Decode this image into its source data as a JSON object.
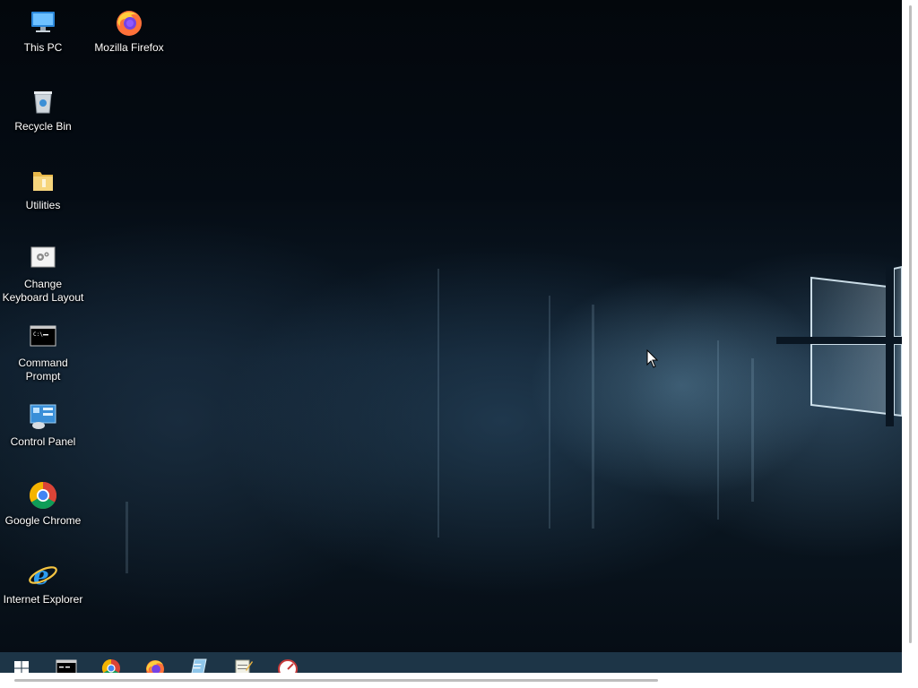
{
  "desktop": {
    "icons": [
      {
        "label": "This PC",
        "icon": "this-pc-icon"
      },
      {
        "label": "Mozilla Firefox",
        "icon": "firefox-icon"
      },
      {
        "label": "Recycle Bin",
        "icon": "recycle-bin-icon"
      },
      {
        "label": "Utilities",
        "icon": "folder-icon"
      },
      {
        "label": "Change\nKeyboard Layout",
        "icon": "keyboard-settings-icon"
      },
      {
        "label": "Command\nPrompt",
        "icon": "command-prompt-icon"
      },
      {
        "label": "Control Panel",
        "icon": "control-panel-icon"
      },
      {
        "label": "Google Chrome",
        "icon": "chrome-icon"
      },
      {
        "label": "Internet Explorer",
        "icon": "internet-explorer-icon"
      }
    ]
  },
  "taskbar": {
    "items": [
      {
        "icon": "windows-start-icon"
      },
      {
        "icon": "command-prompt-icon"
      },
      {
        "icon": "chrome-icon"
      },
      {
        "icon": "firefox-icon"
      },
      {
        "icon": "document-icon"
      },
      {
        "icon": "notepad-icon"
      },
      {
        "icon": "speedometer-icon"
      }
    ]
  },
  "colors": {
    "taskbar": "#1d3547",
    "desktop_dark": "#050c14",
    "wallpaper_glow": "#78aac8"
  }
}
